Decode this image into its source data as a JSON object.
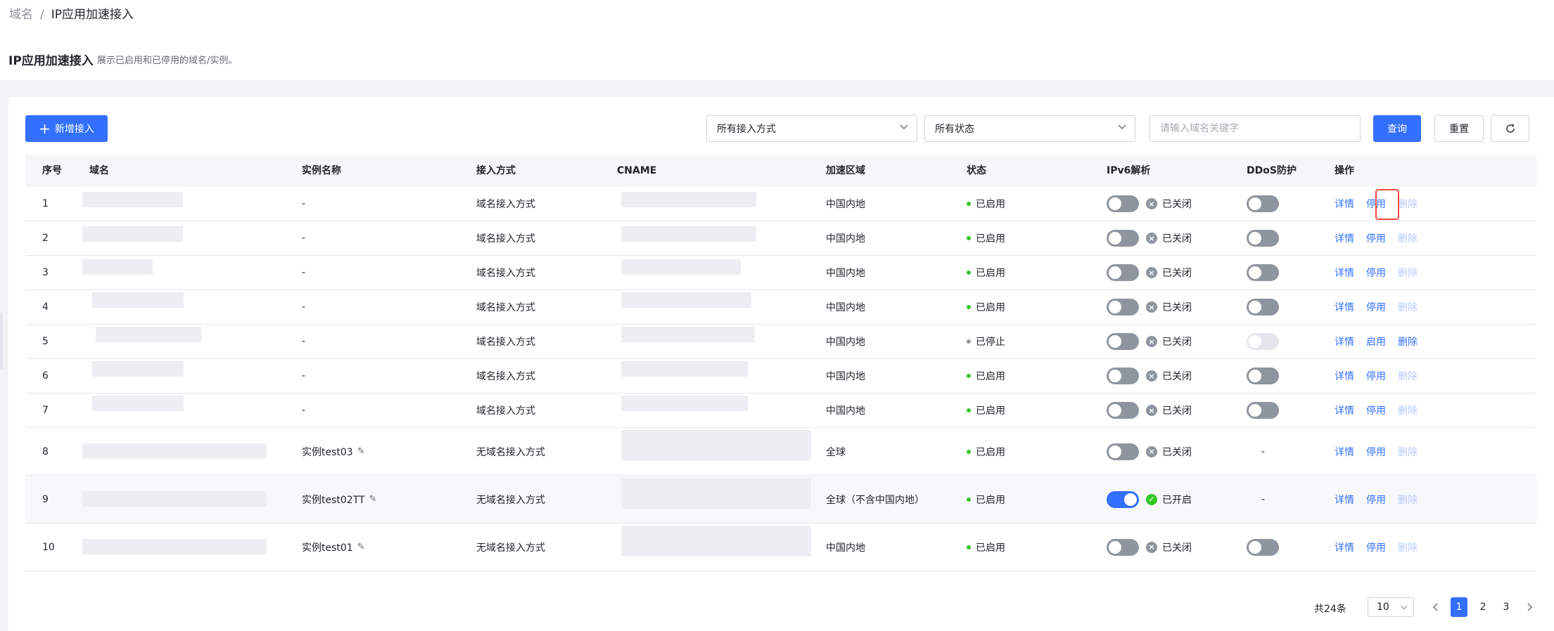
{
  "breadcrumb": {
    "root": "域名",
    "sep": "/",
    "current": "IP应用加速接入"
  },
  "page": {
    "title": "IP应用加速接入",
    "desc": "展示已启用和已停用的域名/实例。"
  },
  "toolbar": {
    "add_label": "新增接入",
    "access_select": "所有接入方式",
    "status_select": "所有状态",
    "search_placeholder": "请输入域名关键字",
    "query_label": "查询",
    "reset_label": "重置"
  },
  "columns": [
    "序号",
    "域名",
    "实例名称",
    "接入方式",
    "CNAME",
    "加速区域",
    "状态",
    "IPv6解析",
    "DDoS防护",
    "操作"
  ],
  "rows": [
    {
      "no": "1",
      "instance": "-",
      "access": "域名接入方式",
      "region": "中国内地",
      "status": "已启用",
      "ipv6": "已关闭",
      "detail": "详情",
      "toggle": "停用",
      "delete": "删除"
    },
    {
      "no": "2",
      "instance": "-",
      "access": "域名接入方式",
      "region": "中国内地",
      "status": "已启用",
      "ipv6": "已关闭",
      "detail": "详情",
      "toggle": "停用",
      "delete": "删除"
    },
    {
      "no": "3",
      "instance": "-",
      "access": "域名接入方式",
      "region": "中国内地",
      "status": "已启用",
      "ipv6": "已关闭",
      "detail": "详情",
      "toggle": "停用",
      "delete": "删除"
    },
    {
      "no": "4",
      "instance": "-",
      "access": "域名接入方式",
      "region": "中国内地",
      "status": "已启用",
      "ipv6": "已关闭",
      "detail": "详情",
      "toggle": "停用",
      "delete": "删除"
    },
    {
      "no": "5",
      "instance": "-",
      "access": "域名接入方式",
      "region": "中国内地",
      "status": "已停止",
      "ipv6": "已关闭",
      "detail": "详情",
      "toggle": "启用",
      "delete": "删除"
    },
    {
      "no": "6",
      "instance": "-",
      "access": "域名接入方式",
      "region": "中国内地",
      "status": "已启用",
      "ipv6": "已关闭",
      "detail": "详情",
      "toggle": "停用",
      "delete": "删除"
    },
    {
      "no": "7",
      "instance": "-",
      "access": "域名接入方式",
      "region": "中国内地",
      "status": "已启用",
      "ipv6": "已关闭",
      "detail": "详情",
      "toggle": "停用",
      "delete": "删除"
    },
    {
      "no": "8",
      "instance": "实例test03",
      "access": "无域名接入方式",
      "region": "全球",
      "status": "已启用",
      "ipv6": "已关闭",
      "ddos": "-",
      "detail": "详情",
      "toggle": "停用",
      "delete": "删除"
    },
    {
      "no": "9",
      "instance": "实例test02TT",
      "access": "无域名接入方式",
      "region": "全球（不含中国内地）",
      "status": "已启用",
      "ipv6": "已开启",
      "ddos": "-",
      "detail": "详情",
      "toggle": "停用",
      "delete": "删除"
    },
    {
      "no": "10",
      "instance": "实例test01",
      "access": "无域名接入方式",
      "region": "中国内地",
      "status": "已启用",
      "ipv6": "已关闭",
      "detail": "详情",
      "toggle": "停用",
      "delete": "删除"
    }
  ],
  "pagination": {
    "total": "共24条",
    "page_size": "10",
    "pages": [
      "1",
      "2",
      "3"
    ]
  },
  "colors": {
    "primary": "#3370ff",
    "success": "#34c724",
    "stopped": "#8f959e",
    "highlight": "#f54a45"
  }
}
